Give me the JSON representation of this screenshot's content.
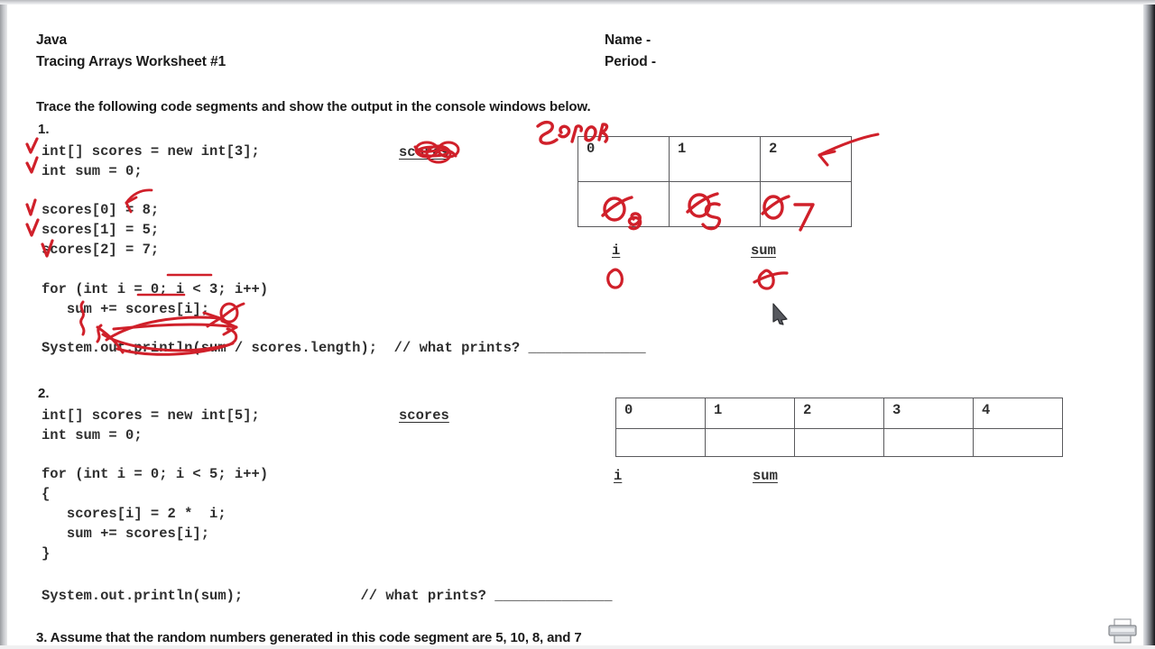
{
  "document": {
    "header": {
      "left_line1": "Java",
      "left_line2": "Tracing Arrays Worksheet #1",
      "right_line1": "Name -",
      "right_line2": "Period -"
    },
    "instruction": "Trace the following code segments and show the output in the console windows below.",
    "question3": "3. Assume that the random numbers generated in this code segment are 5, 10, 8, and 7"
  },
  "problem1": {
    "number": "1.",
    "code_top": "int[] scores = new int[3];\nint sum = 0;\n\nscores[0] = 8;\nscores[1] = 5;\nscores[2] = 7;",
    "code_bottom": "for (int i = 0; i < 3; i++)\n   sum += scores[i];\n\nSystem.out.println(sum / scores.length);  // what prints? ______________",
    "array_label": "scores",
    "i_label": "i",
    "sum_label": "sum",
    "table": {
      "indices": [
        "0",
        "1",
        "2"
      ],
      "values": [
        "",
        "",
        ""
      ]
    },
    "annotations": {
      "array_title_handwritten": "Scores",
      "cell_values_handwritten": [
        "8",
        "5",
        "7"
      ],
      "crossed_out_value": "0",
      "i_value_handwritten": "0",
      "sum_value_handwritten": "0",
      "checkmarks": 5,
      "ink_color": "#d0202a"
    }
  },
  "problem2": {
    "number": "2.",
    "code_top": "int[] scores = new int[5];\nint sum = 0;\n\nfor (int i = 0; i < 5; i++)\n{\n   scores[i] = 2 *  i;\n   sum += scores[i];\n}",
    "code_bottom": "System.out.println(sum);              // what prints? ______________",
    "array_label": "scores",
    "i_label": "i",
    "sum_label": "sum",
    "table": {
      "indices": [
        "0",
        "1",
        "2",
        "3",
        "4"
      ],
      "values": [
        "",
        "",
        "",
        "",
        ""
      ]
    }
  },
  "player": {
    "cursor_icon": "pen-cursor",
    "toolbar_icon": "printer-icon"
  },
  "colors": {
    "ink": "#d0202a",
    "text": "#2e2e2e",
    "heading": "#1a1a1a",
    "table_border": "#59595c",
    "page_background": "#ffffff"
  }
}
